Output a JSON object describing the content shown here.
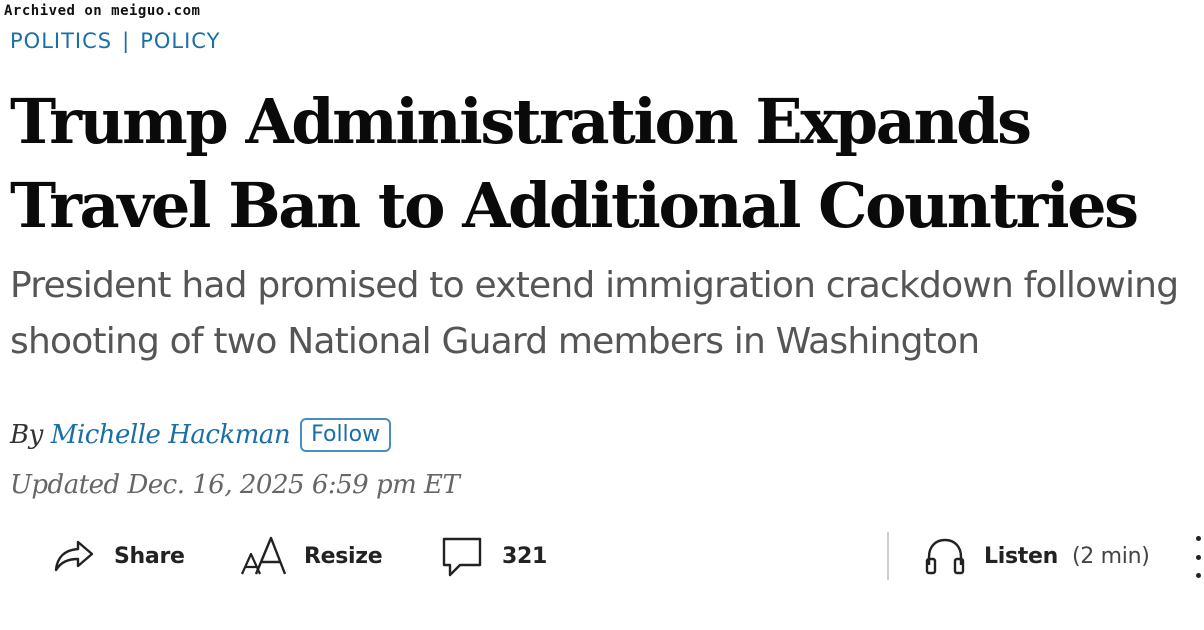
{
  "watermark": "Archived on meiguo.com",
  "section_nav": {
    "items": [
      "POLITICS",
      "POLICY"
    ],
    "separator": "|"
  },
  "article": {
    "headline": "Trump Administration Expands Travel Ban to Additional Countries",
    "dek": "President had promised to extend immigration crackdown following shooting of two National Guard members in Washington",
    "byline_prefix": "By",
    "author": "Michelle Hackman",
    "follow_label": "Follow",
    "timestamp": "Updated Dec. 16, 2025 6:59 pm ET"
  },
  "toolbar": {
    "share_label": "Share",
    "resize_label": "Resize",
    "comment_count": "321",
    "listen_label": "Listen",
    "listen_duration": "(2 min)",
    "icons": [
      "share-icon",
      "resize-icon",
      "comment-icon",
      "headphones-icon",
      "more-vertical-icon"
    ]
  },
  "colors": {
    "accent_blue": "#1a6fa6",
    "headline": "#0a0a0a",
    "dek": "#555555",
    "timestamp": "#666666"
  }
}
